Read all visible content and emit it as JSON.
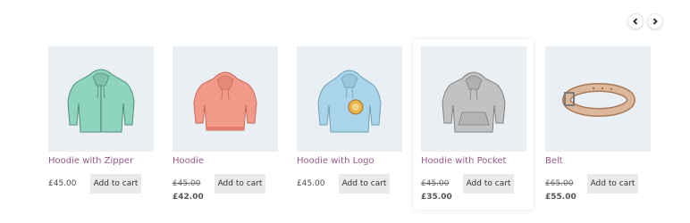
{
  "carousel": {
    "prev_icon": "chevron-left-icon",
    "next_icon": "chevron-right-icon"
  },
  "products": [
    {
      "name": "Hoodie with Zipper",
      "price": "£45.00",
      "old_price": "",
      "button": "Add to cart",
      "color": "#8fd4bd"
    },
    {
      "name": "Hoodie",
      "price": "£42.00",
      "old_price": "£45.00",
      "button": "Add to cart",
      "color": "#f29a8a"
    },
    {
      "name": "Hoodie with Logo",
      "price": "£45.00",
      "old_price": "",
      "button": "Add to cart",
      "color": "#a9d4ea"
    },
    {
      "name": "Hoodie with Pocket",
      "price": "£35.00",
      "old_price": "£45.00",
      "button": "Add to cart",
      "color": "#c2c2c2"
    },
    {
      "name": "Belt",
      "price": "£55.00",
      "old_price": "£65.00",
      "button": "Add to cart",
      "color": "#ddb79a"
    }
  ]
}
